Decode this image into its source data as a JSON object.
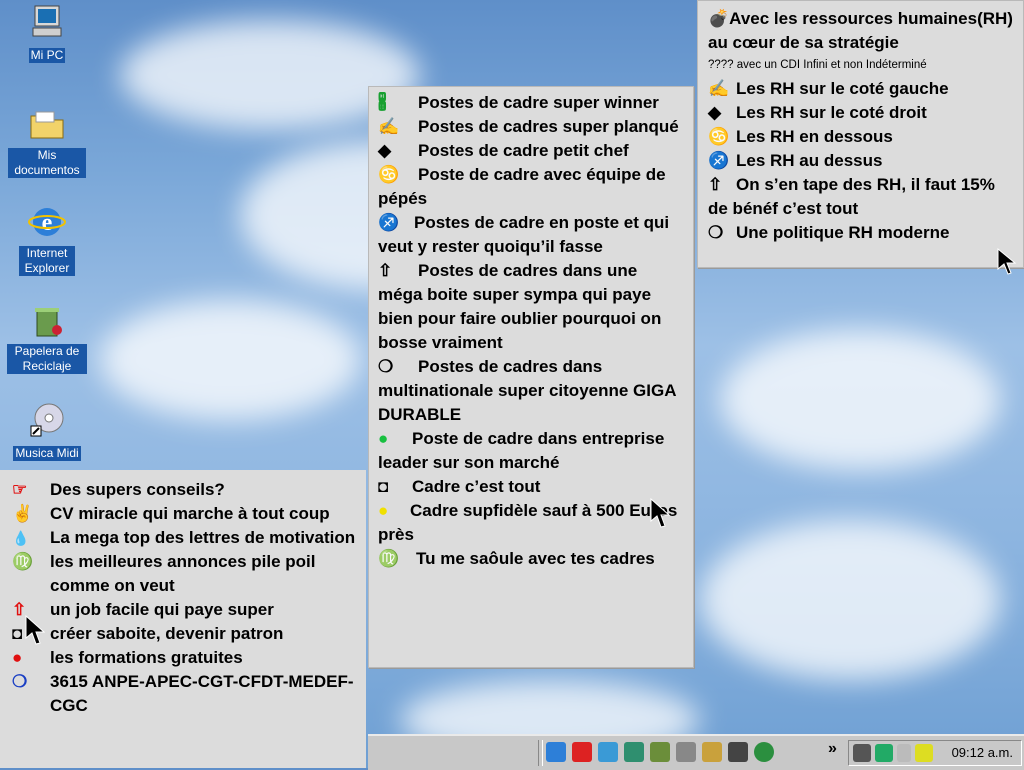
{
  "desktop": {
    "icons": [
      {
        "label": "Mi PC",
        "icon": "computer-icon"
      },
      {
        "label": "Mis documentos",
        "icon": "folder-icon"
      },
      {
        "label": "Internet Explorer",
        "icon": "internet-explorer-icon"
      },
      {
        "label": "Papelera de Reciclaje",
        "icon": "recycle-bin-icon"
      },
      {
        "label": "Musica Midi",
        "icon": "cd-icon"
      }
    ]
  },
  "top_right_panel": {
    "title": "Avec les ressources humaines(RH) au cœur de sa stratégie",
    "note": "???? avec un CDI Infini et non Indéterminé",
    "items": [
      {
        "bullet": "✍",
        "text": "Les RH sur le coté gauche"
      },
      {
        "bullet": "◆",
        "text": "Les RH sur le coté droit"
      },
      {
        "bullet": "♋",
        "text": "Les RH en dessous"
      },
      {
        "bullet": "♐",
        "text": "Les RH au dessus"
      },
      {
        "bullet": "⇧",
        "text": "On s’en tape des RH, il faut 15% de bénéf c’est tout"
      },
      {
        "bullet": "❍",
        "text": "Une politique RH moderne"
      }
    ]
  },
  "center_panel": {
    "items": [
      {
        "bullet": "🖁",
        "text": "Postes de cadre super winner"
      },
      {
        "bullet": "✍",
        "text": "Postes de cadres super planqué"
      },
      {
        "bullet": "◆",
        "text": "Postes de cadre petit chef"
      },
      {
        "bullet": "♋",
        "text": "Poste de cadre avec équipe de pépés"
      },
      {
        "bullet": "♐",
        "text": "Postes de cadre en poste et qui veut y rester quoiqu’il fasse"
      },
      {
        "bullet": "⇧",
        "text": "Postes de cadres dans une méga boite super sympa qui paye bien  pour faire oublier pourquoi on bosse vraiment"
      },
      {
        "bullet": "❍",
        "text": "Postes de cadres dans multinationale super citoyenne GIGA DURABLE"
      },
      {
        "bullet": "●",
        "text": "Poste de cadre dans entreprise leader sur son marché"
      },
      {
        "bullet": "◘",
        "text": "Cadre c’est tout"
      },
      {
        "bullet": "●",
        "text": "Cadre supfidèle sauf à 500 Euros près"
      },
      {
        "bullet": "♍",
        "text": "Tu me saôule avec tes cadres"
      }
    ]
  },
  "left_list": {
    "items": [
      {
        "bullet": "☞",
        "text": "Des supers conseils?"
      },
      {
        "bullet": "✌",
        "text": "CV miracle qui marche à tout coup"
      },
      {
        "bullet": "💧",
        "text": "La mega top des lettres de motivation"
      },
      {
        "bullet": "♍",
        "text": "les meilleures annonces pile poil comme on veut"
      },
      {
        "bullet": "⇧",
        "text": "un job facile qui paye super"
      },
      {
        "bullet": "◘",
        "text": "créer saboite, devenir patron"
      },
      {
        "bullet": "●",
        "text": "les formations gratuites"
      },
      {
        "bullet": "❍",
        "text": "3615 ANPE-APEC-CGT-CFDT-MEDEF-CGC"
      }
    ]
  },
  "taskbar": {
    "chevron": "»",
    "clock": "09:12 a.m."
  },
  "colors": {
    "panel_bg": "#dcdcdc",
    "icon_label_bg": "#1a57a6",
    "accent_blue": "#1a3fc4",
    "accent_red": "#e01010",
    "accent_yellow": "#f0e000",
    "accent_green": "#18c040"
  }
}
